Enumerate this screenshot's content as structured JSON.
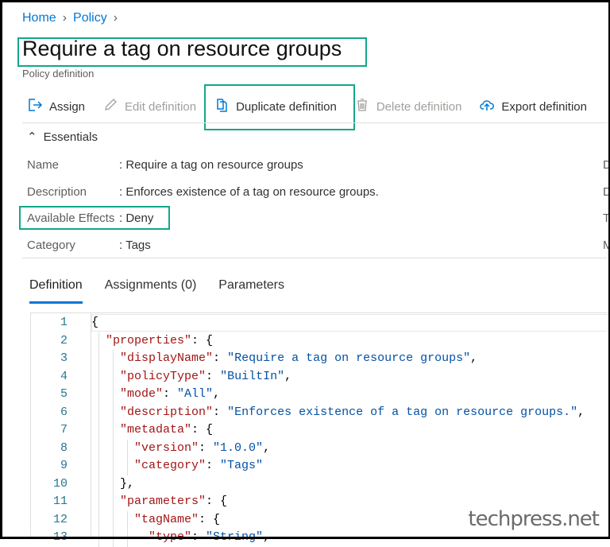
{
  "breadcrumb": [
    "Home",
    "Policy"
  ],
  "title": "Require a tag on resource groups",
  "subtitle": "Policy definition",
  "toolbar": [
    {
      "label": "Assign",
      "icon": "assign-icon",
      "disabled": false
    },
    {
      "label": "Edit definition",
      "icon": "pencil-icon",
      "disabled": true
    },
    {
      "label": "Duplicate definition",
      "icon": "duplicate-icon",
      "disabled": false
    },
    {
      "label": "Delete definition",
      "icon": "trash-icon",
      "disabled": true
    },
    {
      "label": "Export definition",
      "icon": "cloud-upload-icon",
      "disabled": false
    }
  ],
  "essentials": {
    "label": "Essentials",
    "fields": [
      {
        "label": "Name",
        "value": ": Require a tag on resource groups",
        "trunc": "D"
      },
      {
        "label": "Description",
        "value": ": Enforces existence of a tag on resource groups.",
        "trunc": "D"
      },
      {
        "label": "Available Effects",
        "value": ": Deny",
        "trunc": "T"
      },
      {
        "label": "Category",
        "value": ": Tags",
        "trunc": "M"
      }
    ]
  },
  "tabs": [
    "Definition",
    "Assignments (0)",
    "Parameters"
  ],
  "code": [
    [
      0,
      [
        [
          "p",
          "{"
        ]
      ]
    ],
    [
      1,
      [
        [
          "k",
          "\"properties\""
        ],
        [
          "p",
          ": {"
        ]
      ]
    ],
    [
      2,
      [
        [
          "k",
          "\"displayName\""
        ],
        [
          "p",
          ": "
        ],
        [
          "s",
          "\"Require a tag on resource groups\""
        ],
        [
          "p",
          ","
        ]
      ]
    ],
    [
      2,
      [
        [
          "k",
          "\"policyType\""
        ],
        [
          "p",
          ": "
        ],
        [
          "s",
          "\"BuiltIn\""
        ],
        [
          "p",
          ","
        ]
      ]
    ],
    [
      2,
      [
        [
          "k",
          "\"mode\""
        ],
        [
          "p",
          ": "
        ],
        [
          "s",
          "\"All\""
        ],
        [
          "p",
          ","
        ]
      ]
    ],
    [
      2,
      [
        [
          "k",
          "\"description\""
        ],
        [
          "p",
          ": "
        ],
        [
          "s",
          "\"Enforces existence of a tag on resource groups.\""
        ],
        [
          "p",
          ","
        ]
      ]
    ],
    [
      2,
      [
        [
          "k",
          "\"metadata\""
        ],
        [
          "p",
          ": {"
        ]
      ]
    ],
    [
      3,
      [
        [
          "k",
          "\"version\""
        ],
        [
          "p",
          ": "
        ],
        [
          "s",
          "\"1.0.0\""
        ],
        [
          "p",
          ","
        ]
      ]
    ],
    [
      3,
      [
        [
          "k",
          "\"category\""
        ],
        [
          "p",
          ": "
        ],
        [
          "s",
          "\"Tags\""
        ]
      ]
    ],
    [
      2,
      [
        [
          "p",
          "},"
        ]
      ]
    ],
    [
      2,
      [
        [
          "k",
          "\"parameters\""
        ],
        [
          "p",
          ": {"
        ]
      ]
    ],
    [
      3,
      [
        [
          "k",
          "\"tagName\""
        ],
        [
          "p",
          ": {"
        ]
      ]
    ],
    [
      4,
      [
        [
          "k",
          "\"type\""
        ],
        [
          "p",
          ": "
        ],
        [
          "s",
          "\"String\""
        ],
        [
          "p",
          ","
        ]
      ]
    ]
  ],
  "watermark": "techpress.net"
}
